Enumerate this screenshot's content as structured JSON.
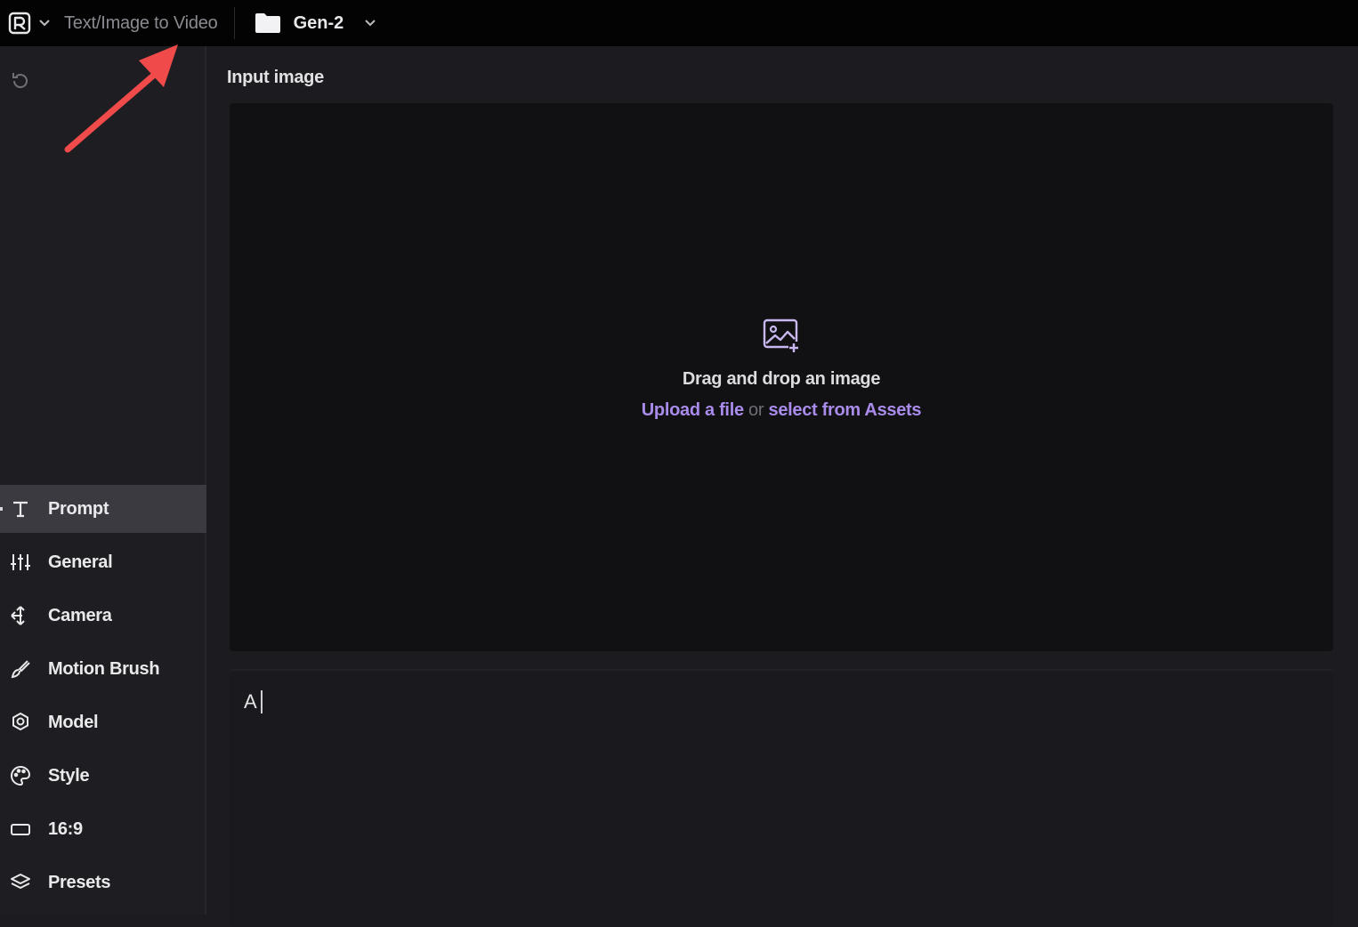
{
  "app": {
    "tool_title": "Text/Image to Video",
    "project_name": "Gen-2",
    "logo_icon": "runway-logo-icon",
    "folder_icon": "folder-icon"
  },
  "sidebar": {
    "reset_icon": "reset-icon",
    "items": [
      {
        "label": "Prompt",
        "icon": "text-icon",
        "active": true
      },
      {
        "label": "General",
        "icon": "sliders-icon",
        "active": false
      },
      {
        "label": "Camera",
        "icon": "camera-move-icon",
        "active": false
      },
      {
        "label": "Motion Brush",
        "icon": "brush-icon",
        "active": false
      },
      {
        "label": "Model",
        "icon": "model-icon",
        "active": false
      },
      {
        "label": "Style",
        "icon": "palette-icon",
        "active": false
      },
      {
        "label": "16:9",
        "icon": "aspect-ratio-icon",
        "active": false
      },
      {
        "label": "Presets",
        "icon": "layers-icon",
        "active": false
      }
    ]
  },
  "main": {
    "input_label": "Input image",
    "dropzone": {
      "title": "Drag and drop an image",
      "upload_link": "Upload a file",
      "or_text": "or",
      "assets_link": "select from Assets",
      "icon": "image-add-icon"
    },
    "prompt": {
      "value": "A"
    }
  },
  "colors": {
    "topbar_bg": "#030304",
    "sidebar_bg": "#1e1e22",
    "dropzone_bg": "#111114",
    "active_item_bg": "#3a3a40",
    "link": "#a98bea",
    "annotation_arrow": "#f04a4a"
  }
}
